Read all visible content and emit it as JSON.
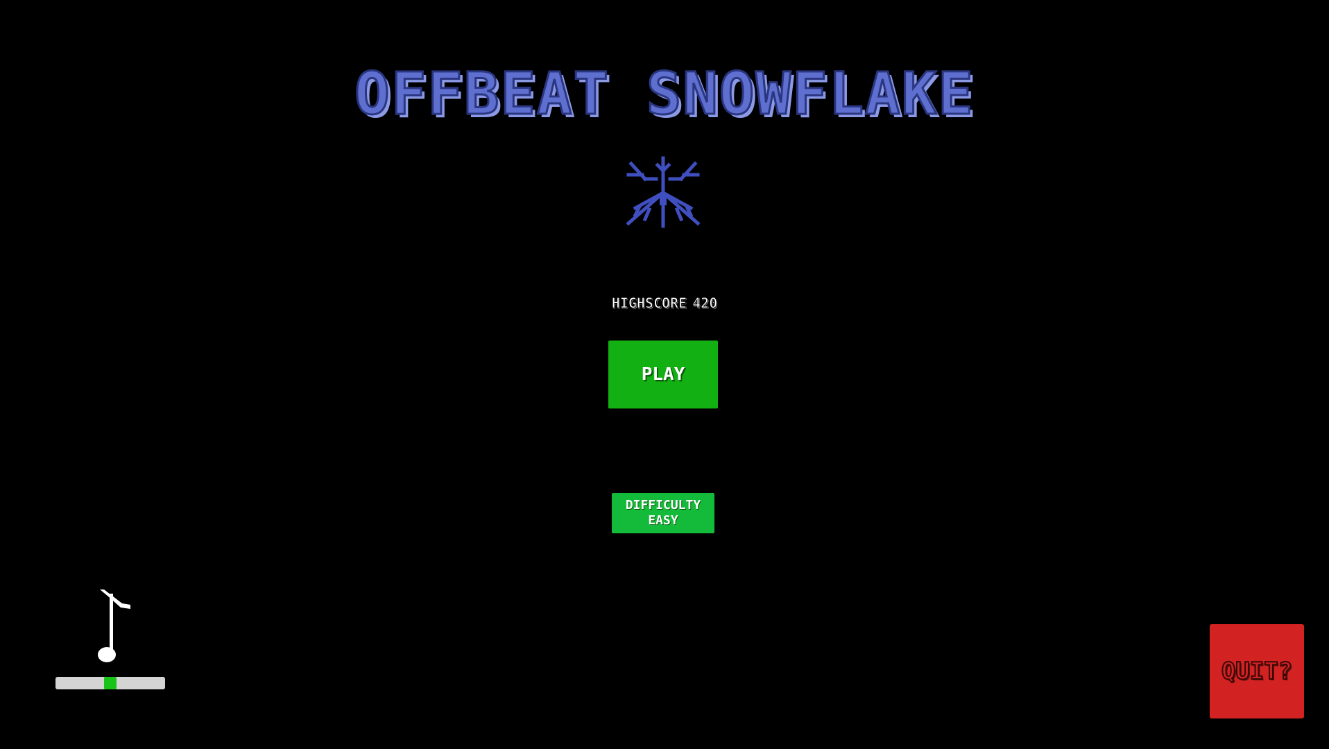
{
  "title": "OFFBEAT SNOWFLAKE",
  "highscore": {
    "label": "HIGHSCORE",
    "value": "420"
  },
  "buttons": {
    "play": "PLAY",
    "difficulty_label": "DIFFICULTY",
    "difficulty_value": "EASY",
    "quit": "QUIT?"
  },
  "volume": {
    "level": 0.5
  },
  "icons": {
    "logo": "snowflake-icon",
    "music": "music-note-icon"
  },
  "colors": {
    "background": "#000000",
    "title": "#5e6fd0",
    "snowflake": "#3f4fbf",
    "play": "#13b013",
    "difficulty": "#14bb3a",
    "quit": "#d32222",
    "volume_track": "#d4d4d4",
    "volume_thumb": "#19c419"
  }
}
